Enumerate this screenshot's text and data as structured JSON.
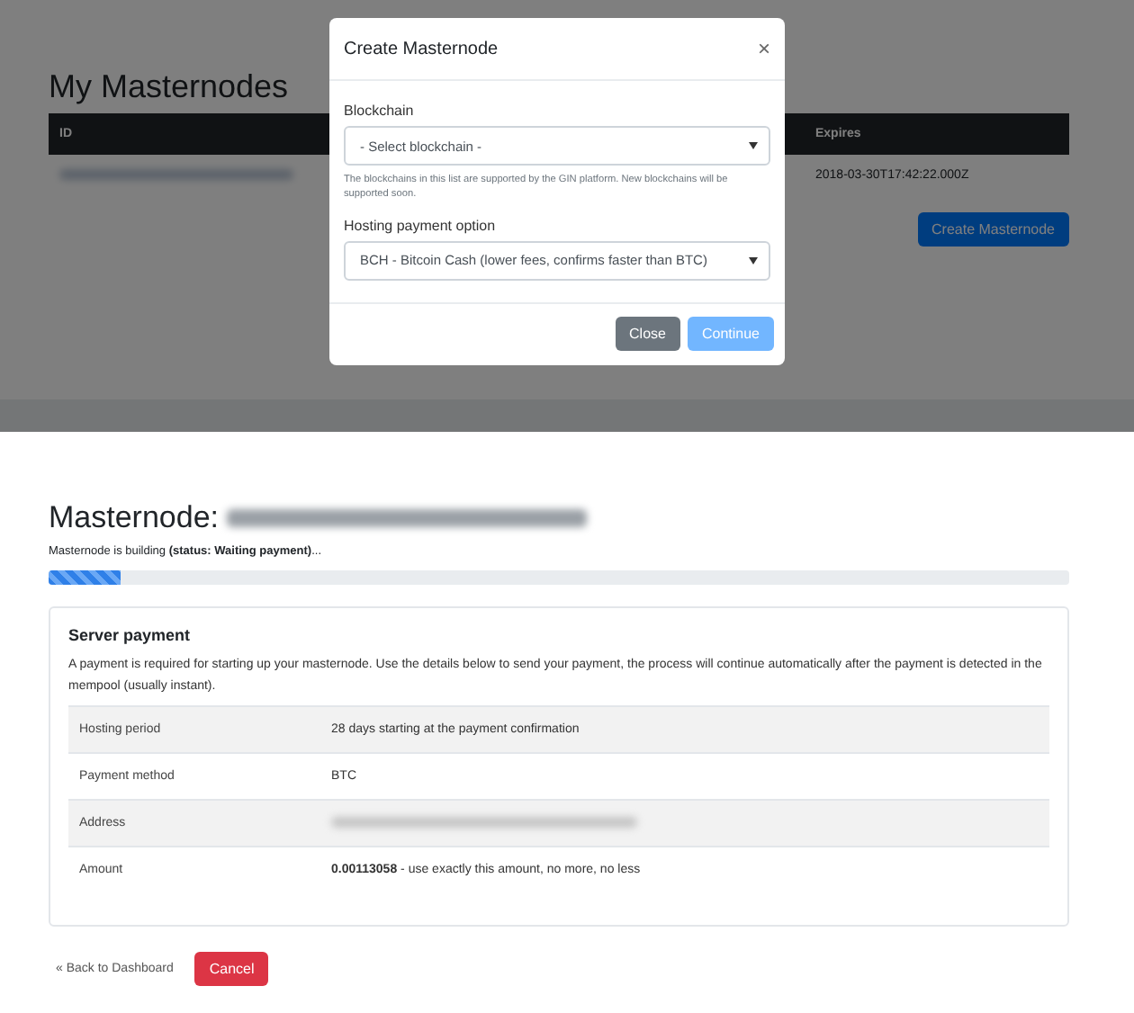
{
  "background_page": {
    "title": "My Masternodes",
    "table": {
      "columns": [
        "ID",
        "Expires"
      ],
      "rows": [
        {
          "expires": "2018-03-30T17:42:22.000Z"
        }
      ]
    },
    "create_button": "Create Masternode"
  },
  "modal": {
    "title": "Create Masternode",
    "close": "×",
    "fields": [
      {
        "label": "Blockchain",
        "value": "- Select blockchain -",
        "help": "The blockchains in this list are supported by the GIN platform. New blockchains will be supported soon."
      },
      {
        "label": "Hosting payment option",
        "value": "BCH - Bitcoin Cash (lower fees, confirms faster than BTC)"
      }
    ],
    "buttons": [
      {
        "label": "Close",
        "kind": "secondary",
        "disabled": false
      },
      {
        "label": "Continue",
        "kind": "primary",
        "disabled": true
      }
    ]
  },
  "masternode": {
    "title": "Masternode:",
    "status": "Masternode is building **(status: Waiting payment)**...",
    "progress": {
      "level": 0.07
    },
    "card": {
      "title": "Server payment",
      "description": "A payment is required for starting up your masternode. Use the details below to send your payment, the process will continue automatically after the payment is detected in the mempool (usually instant).",
      "rows": [
        {
          "label": "Hosting period",
          "value": "28 days starting at the payment confirmation"
        },
        {
          "label": "Payment method",
          "value": "BTC"
        },
        {
          "label": "Address",
          "blurred": true
        },
        {
          "label": "Amount",
          "value": "**0.00113058** - use exactly this amount, no more, no less"
        }
      ]
    },
    "back_link": "« Back to Dashboard",
    "cancel_button": "Cancel"
  }
}
